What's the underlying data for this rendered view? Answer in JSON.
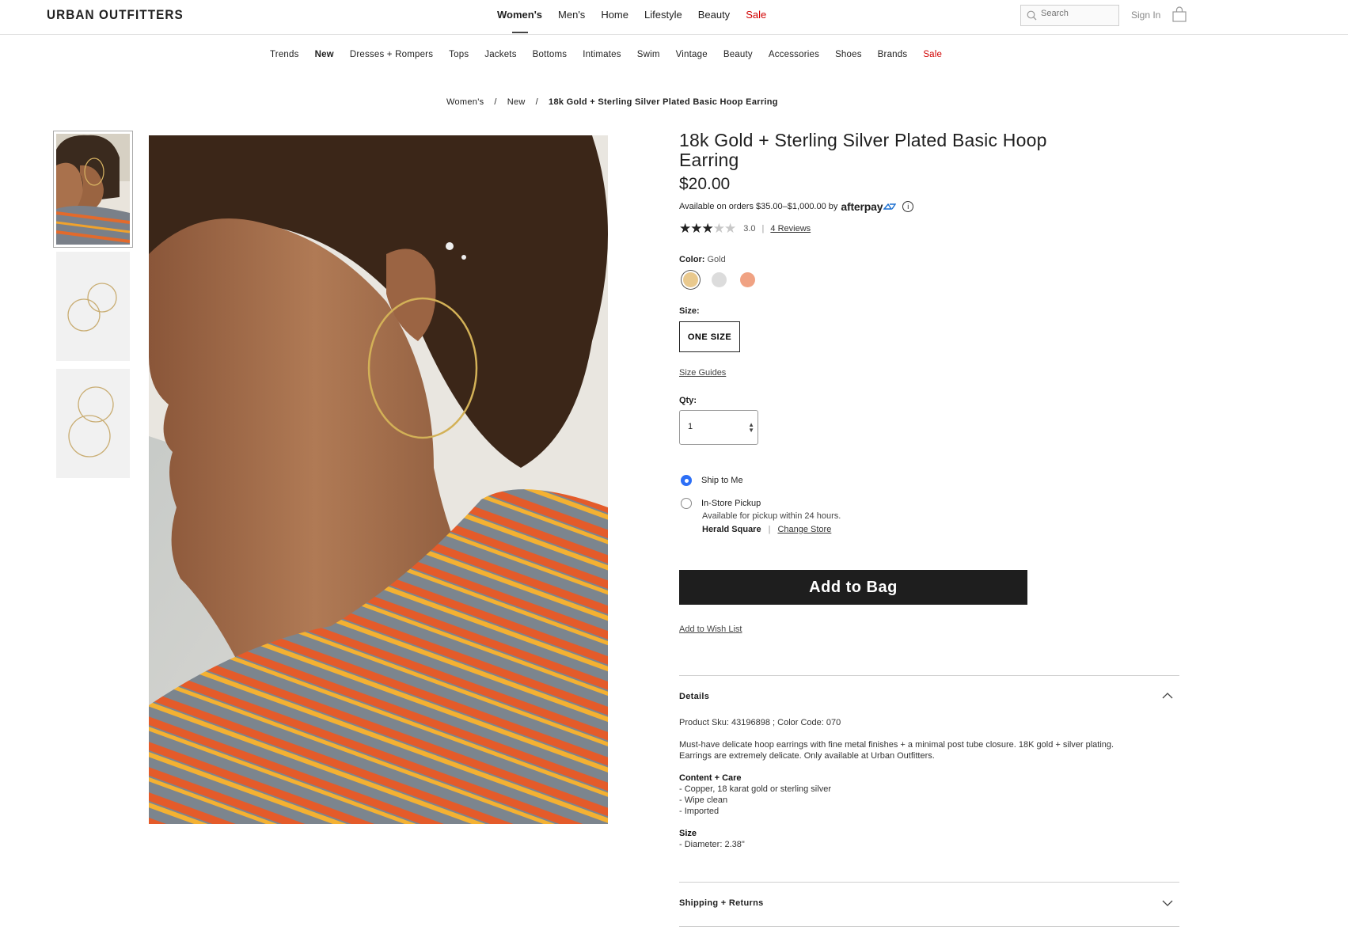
{
  "brand": "URBAN OUTFITTERS",
  "main_nav": [
    {
      "label": "Women's",
      "active": true
    },
    {
      "label": "Men's"
    },
    {
      "label": "Home"
    },
    {
      "label": "Lifestyle"
    },
    {
      "label": "Beauty"
    },
    {
      "label": "Sale",
      "sale": true
    }
  ],
  "search": {
    "placeholder": "Search",
    "icon": "search-icon"
  },
  "sign_in": "Sign In",
  "sub_nav": [
    "Trends",
    "New",
    "Dresses + Rompers",
    "Tops",
    "Jackets",
    "Bottoms",
    "Intimates",
    "Swim",
    "Vintage",
    "Beauty",
    "Accessories",
    "Shoes",
    "Brands",
    "Sale"
  ],
  "breadcrumb": [
    "Women's",
    "New",
    "18k Gold + Sterling Silver Plated Basic Hoop Earring"
  ],
  "breadcrumb_sep": "/",
  "product": {
    "title": "18k Gold + Sterling Silver Plated Basic Hoop Earring",
    "price": "$20.00",
    "afterpay_text": "Available on orders $35.00–$1,000.00 by",
    "afterpay_logo": "afterpay",
    "afterpay_info": "i",
    "rating": {
      "score": "3.0",
      "stars": 3,
      "max": 5,
      "reviews": "4 Reviews"
    },
    "color_label": "Color:",
    "color_value": "Gold",
    "colors": [
      {
        "name": "Gold",
        "hex": "#e9c98e",
        "selected": true
      },
      {
        "name": "Silver",
        "hex": "#dcdcdc"
      },
      {
        "name": "Rose Gold",
        "hex": "#f0a283"
      }
    ],
    "size_label": "Size:",
    "size_value": "ONE SIZE",
    "size_guides": "Size Guides",
    "qty_label": "Qty:",
    "qty_value": "1",
    "shipping": {
      "ship_to_me": "Ship to Me",
      "pickup": "In-Store Pickup",
      "pickup_note": "Available for pickup within 24 hours.",
      "store": "Herald Square",
      "change_store": "Change Store"
    },
    "add_to_bag": "Add to Bag",
    "wish_list": "Add to Wish List",
    "details_title": "Details",
    "details": {
      "sku": "Product Sku: 43196898 ; Color Code: 070",
      "description": "Must-have delicate hoop earrings with fine metal finishes + a minimal post tube closure. 18K gold + silver plating. Earrings are extremely delicate. Only available at Urban Outfitters.",
      "care_heading": "Content + Care",
      "care": [
        "- Copper, 18 karat gold or sterling silver",
        "- Wipe clean",
        "- Imported"
      ],
      "size_heading": "Size",
      "size": [
        "- Diameter: 2.38\""
      ]
    },
    "shipping_returns_title": "Shipping + Returns"
  },
  "colors": {
    "sale": "#d10000",
    "radio": "#2d6ff6",
    "button": "#1e1e1e"
  }
}
